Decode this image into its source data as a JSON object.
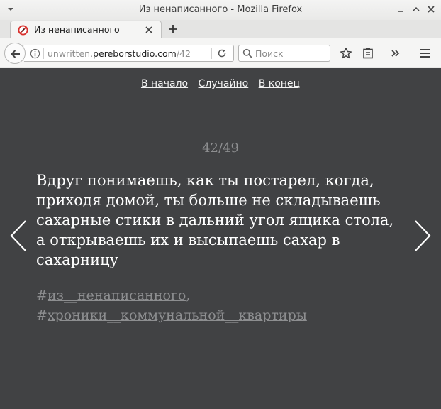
{
  "window": {
    "title": "Из ненаписанного - Mozilla Firefox"
  },
  "tab": {
    "label": "Из ненаписанного"
  },
  "navbar": {
    "url_prefix": "unwritten.",
    "url_host": "pereborstudio.com",
    "url_path": "/42",
    "search_placeholder": "Поиск"
  },
  "page": {
    "nav": {
      "start": "В начало",
      "random": "Случайно",
      "end": "В конец"
    },
    "counter": "42/49",
    "story": "Вдруг понимаешь, как ты постарел, когда, приходя домой, ты больше не складываешь сахарные стики в дальний угол ящика стола, а открываешь их и высыпаешь сахар в сахарницу",
    "tags": [
      {
        "hash": "#",
        "label": "из__ненаписанного",
        "suffix": ","
      },
      {
        "hash": "#",
        "label": "хроники__коммунальной__квартиры",
        "suffix": ""
      }
    ]
  },
  "icons": {
    "window_menu": "chevron-down-icon",
    "minimize": "minimize-icon",
    "maximize": "maximize-icon",
    "close": "close-icon",
    "favicon": "no-pen-icon",
    "back": "back-arrow-icon",
    "info": "info-icon",
    "reload": "reload-icon",
    "search": "search-icon",
    "bookmark": "star-icon",
    "reader": "clipboard-icon",
    "overflow": "double-chevron-icon",
    "menu": "hamburger-icon",
    "prev": "chevron-left-icon",
    "next": "chevron-right-icon"
  },
  "colors": {
    "page_background": "#414244",
    "story_text": "#ffffff",
    "muted_text": "#8d8e90",
    "favicon_red": "#d9302c"
  }
}
